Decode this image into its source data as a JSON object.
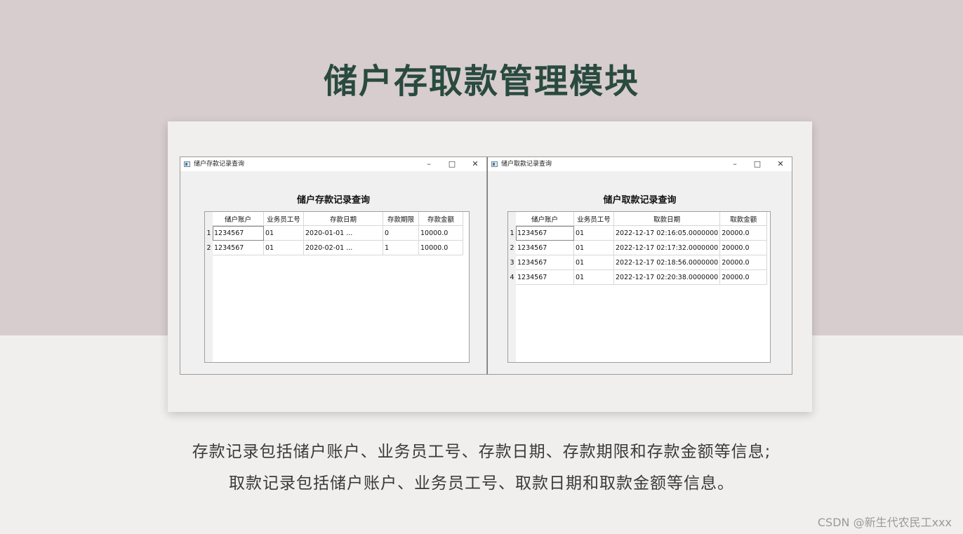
{
  "slide": {
    "title": "储户存取款管理模块",
    "caption_line1": "存款记录包括储户账户、业务员工号、存款日期、存款期限和存款金额等信息;",
    "caption_line2": "取款记录包括储户账户、业务员工号、取款日期和取款金额等信息。",
    "watermark": "CSDN @新生代农民工xxx"
  },
  "colors": {
    "top_band": "#d7cdce",
    "title": "#2a4a40",
    "background": "#f1efee"
  },
  "deposit_window": {
    "title": "储户存款记录查询",
    "controls": {
      "minimize": "–",
      "maximize": "□",
      "close": "✕"
    },
    "heading": "储户存款记录查询",
    "columns": [
      "储户账户",
      "业务员工号",
      "存款日期",
      "存款期限",
      "存款金额"
    ],
    "rows": [
      {
        "num": "1",
        "cells": [
          "1234567",
          "01",
          "2020-01-01 ...",
          "0",
          "10000.0"
        ]
      },
      {
        "num": "2",
        "cells": [
          "1234567",
          "01",
          "2020-02-01 ...",
          "1",
          "10000.0"
        ]
      }
    ]
  },
  "withdraw_window": {
    "title": "储户取款记录查询",
    "controls": {
      "minimize": "–",
      "maximize": "□",
      "close": "✕"
    },
    "heading": "储户取款记录查询",
    "columns": [
      "储户账户",
      "业务员工号",
      "取款日期",
      "取款金额"
    ],
    "rows": [
      {
        "num": "1",
        "cells": [
          "1234567",
          "01",
          "2022-12-17 02:16:05.0000000",
          "20000.0"
        ]
      },
      {
        "num": "2",
        "cells": [
          "1234567",
          "01",
          "2022-12-17 02:17:32.0000000",
          "20000.0"
        ]
      },
      {
        "num": "3",
        "cells": [
          "1234567",
          "01",
          "2022-12-17 02:18:56.0000000",
          "20000.0"
        ]
      },
      {
        "num": "4",
        "cells": [
          "1234567",
          "01",
          "2022-12-17 02:20:38.0000000",
          "20000.0"
        ]
      }
    ]
  }
}
